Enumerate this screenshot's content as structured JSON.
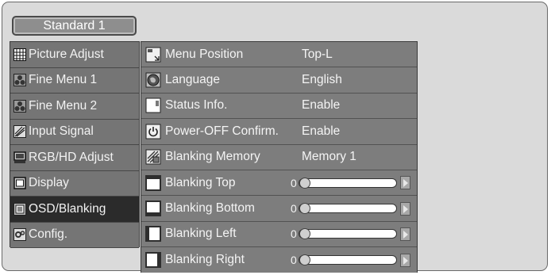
{
  "header": {
    "tab_label": "Standard 1"
  },
  "sidebar": {
    "items": [
      {
        "label": "Picture Adjust",
        "icon": "grid-icon",
        "selected": false
      },
      {
        "label": "Fine Menu 1",
        "icon": "fine-menu-icon",
        "selected": false
      },
      {
        "label": "Fine Menu 2",
        "icon": "fine-menu-icon",
        "selected": false
      },
      {
        "label": "Input Signal",
        "icon": "input-signal-icon",
        "selected": false
      },
      {
        "label": "RGB/HD Adjust",
        "icon": "monitor-icon",
        "selected": false
      },
      {
        "label": "Display",
        "icon": "display-icon",
        "selected": false
      },
      {
        "label": "OSD/Blanking",
        "icon": "osd-icon",
        "selected": true
      },
      {
        "label": "Config.",
        "icon": "config-icon",
        "selected": false
      }
    ]
  },
  "main": {
    "items": [
      {
        "label": "Menu Position",
        "value": "Top-L",
        "icon": "menu-position-icon"
      },
      {
        "label": "Language",
        "value": "English",
        "icon": "globe-icon"
      },
      {
        "label": "Status Info.",
        "value": "Enable",
        "icon": "status-info-icon"
      },
      {
        "label": "Power-OFF Confirm.",
        "value": "Enable",
        "icon": "power-icon"
      },
      {
        "label": "Blanking Memory",
        "value": "Memory 1",
        "icon": "blanking-memory-icon"
      },
      {
        "label": "Blanking Top",
        "slider_value": "0",
        "icon": "blanking-top-icon"
      },
      {
        "label": "Blanking Bottom",
        "slider_value": "0",
        "icon": "blanking-bottom-icon"
      },
      {
        "label": "Blanking Left",
        "slider_value": "0",
        "icon": "blanking-left-icon"
      },
      {
        "label": "Blanking Right",
        "slider_value": "0",
        "icon": "blanking-right-icon"
      }
    ]
  },
  "colors": {
    "selected": "#2b2b2b",
    "row": "#7d7d7d",
    "sidebar_row": "#757575"
  }
}
